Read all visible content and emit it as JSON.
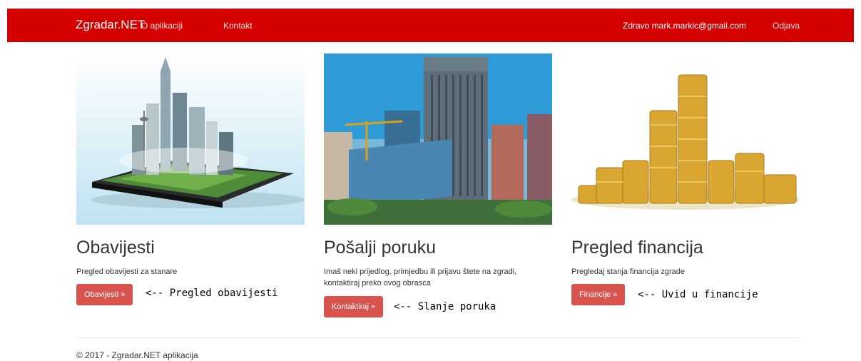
{
  "navbar": {
    "brand": "Zgradar.NET",
    "links": [
      "O aplikaciji",
      "Kontakt"
    ],
    "greeting": "Zdravo mark.markic@gmail.com",
    "logout": "Odjava",
    "color": "#d40000"
  },
  "cards": [
    {
      "image": "city-on-tablet-illustration",
      "title": "Obavijesti",
      "description": "Pregled obavijesti za stanare",
      "button": "Obavijesti »",
      "annotation": "<-- Pregled obavijesti"
    },
    {
      "image": "office-buildings-photo",
      "title": "Pošalji poruku",
      "description": "Imaš neki prijedlog, primjedbu ili prijavu štete na zgradi, kontaktiraj preko ovog obrasca",
      "button": "Kontaktiraj »",
      "annotation": "<-- Slanje poruka"
    },
    {
      "image": "coin-stacks-photo",
      "title": "Pregled financija",
      "description": "Pregledaj stanja financija zgrade",
      "button": "Financije »",
      "annotation": "<-- Uvid u financije"
    }
  ],
  "footer": "© 2017 - Zgradar.NET aplikacija",
  "colors": {
    "button": "#d9534f",
    "navbar": "#d40000"
  }
}
